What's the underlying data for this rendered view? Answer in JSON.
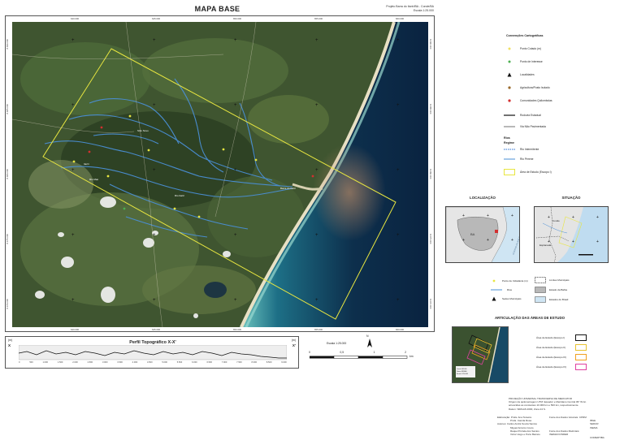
{
  "title": "MAPA BASE",
  "project_line1": "Projeto Barra do Itariri/BA - Conde/BA",
  "project_line2": "Escala 1:25.000",
  "map": {
    "x_ticks": [
      "640.000",
      "645.000",
      "650.000",
      "655.000",
      "660.000"
    ],
    "y_ticks": [
      "8.690.000",
      "8.685.000",
      "8.680.000",
      "8.675.000",
      "8.670.000"
    ]
  },
  "legend": {
    "heading": "Convenções Cartográficas",
    "items": [
      {
        "label": "Ponto Cotado (m)",
        "color": "#f0e060"
      },
      {
        "label": "Ponto de Interesse",
        "color": "#4caf50"
      },
      {
        "label": "Localidades",
        "color": "#111111"
      },
      {
        "label": "Agricultura/Posto Isolado",
        "color": "#9a6a2c"
      },
      {
        "label": "Comunidades Quilombolas",
        "color": "#d32f2f"
      }
    ],
    "roads": [
      {
        "label": "Rodovia Estadual"
      },
      {
        "label": "Via Não Pavimentada"
      }
    ],
    "hydro_heading": "Rios",
    "hydro_sub": "Regime",
    "hydro": [
      {
        "label": "Rio Intermitente"
      },
      {
        "label": "Rio Perene"
      }
    ],
    "area_label": "Área de Estudo (Escopo I)"
  },
  "localizacao": {
    "title": "LOCALIZAÇÃO",
    "state_label": "BA",
    "sea_label": "OCEANO ATLÂNTICO"
  },
  "situacao": {
    "title": "SITUAÇÃO",
    "place1": "Conde",
    "place2": "Esplanada"
  },
  "small_legend": [
    {
      "label": "Ponto de Cidadania (m)"
    },
    {
      "label": "Limites Municipais"
    },
    {
      "label": "Rios"
    },
    {
      "label": "Estado da Bahia"
    },
    {
      "label": "Sedes Municipais"
    },
    {
      "label": "Estados do Brasil"
    }
  ],
  "articulacao": {
    "title": "ARTICULAÇÃO DAS ÁREAS DE ESTUDO",
    "items": [
      {
        "label": "Área de Estudo (Escopo I)",
        "color": "#111111"
      },
      {
        "label": "Área de Estudo (Escopo II)",
        "color": "#e8c230"
      },
      {
        "label": "Área de Estudo (Escopo III)",
        "color": "#f0a020"
      },
      {
        "label": "Área de Estudo (Escopo IV)",
        "color": "#e040a0"
      }
    ]
  },
  "credits": {
    "line1": "PROJEÇÃO UNIVERSAL TRANSVERSA DE MERCATOR",
    "line2": "Origem da quilometragem UTM: Equador e Meridiano Central 39° W.Gr.",
    "line3": "acrescidas as constantes 10.000 km e 500 km, respectivamente.",
    "line4": "Datum: SIRGAS 2000, Zona 24 S.",
    "elab_label": "Elaboração:",
    "elab_names": [
      "Profa. Ana Teixeira",
      "Profa. Camila Rosa"
    ],
    "autores_label": "Autores:",
    "autores_names": [
      "Carlos André Souza Santos",
      "Miguel Antonio Couto",
      "Raquel Portela dos Santos",
      "Victor Hugo e Porto Barreto"
    ],
    "fonte_label": "Fonte dos Dados Vetoriais:",
    "fonte_items": [
      "CPRM",
      "IBGE",
      "SEDUR",
      "INEMA"
    ],
    "fonte2_label": "Fonte dos Dados Matriciais:",
    "fonte2_items": [
      "INEMA/CONDER",
      "COMERTIBA"
    ]
  },
  "profile": {
    "title": "Perfil Topográfico X-X'",
    "left_letter": "X",
    "right_letter": "X'",
    "y_unit": "(m)",
    "x_ticks": [
      "0",
      "500",
      "1.000",
      "1.500",
      "2.000",
      "2.500",
      "3.000",
      "3.500",
      "4.000",
      "4.500",
      "5.000",
      "5.500",
      "6.000",
      "6.500",
      "7.000",
      "7.500",
      "8.000",
      "8.500",
      "9.000"
    ]
  },
  "scale": {
    "label": "Escala 1:25.000",
    "ticks": [
      "0",
      "0,5",
      "1",
      "2"
    ],
    "unit": "km",
    "north": "N"
  }
}
